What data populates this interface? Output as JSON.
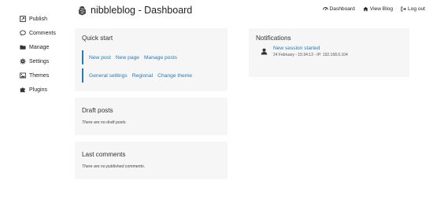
{
  "sidebar": {
    "items": [
      {
        "label": "Publish",
        "icon": "publish-icon"
      },
      {
        "label": "Comments",
        "icon": "comment-icon"
      },
      {
        "label": "Manage",
        "icon": "folder-icon"
      },
      {
        "label": "Settings",
        "icon": "gear-icon"
      },
      {
        "label": "Themes",
        "icon": "image-icon"
      },
      {
        "label": "Plugins",
        "icon": "puzzle-icon"
      }
    ]
  },
  "header": {
    "title": "nibbleblog - Dashboard",
    "logo_icon": "nibbleblog-logo-icon"
  },
  "topnav": {
    "dashboard": "Dashboard",
    "view_blog": "View Blog",
    "log_out": "Log out"
  },
  "quick_start": {
    "title": "Quick start",
    "row1": [
      "New post",
      "New page",
      "Manage posts"
    ],
    "row2": [
      "General settings",
      "Regional",
      "Change theme"
    ]
  },
  "notifications": {
    "title": "Notifications",
    "items": [
      {
        "title": "New session started",
        "meta": "24 February - 15:34:13 - IP: 192.168.0.104"
      }
    ]
  },
  "draft_posts": {
    "title": "Draft posts",
    "empty": "There are no draft posts."
  },
  "last_comments": {
    "title": "Last comments",
    "empty": "There are no published comments."
  },
  "colors": {
    "accent": "#2a7ab8",
    "panel_bg": "#f6f6f6"
  }
}
